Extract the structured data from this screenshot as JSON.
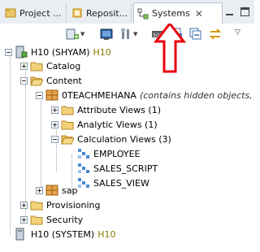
{
  "tabs": [
    {
      "label": "Project ...",
      "icon": "project-explorer-icon",
      "active": false
    },
    {
      "label": "Reposit...",
      "icon": "repository-icon",
      "active": false
    },
    {
      "label": "Systems",
      "icon": "systems-icon",
      "active": true
    }
  ],
  "tree": {
    "system": {
      "name": "H10 (SHYAM)",
      "suffix": "H10"
    },
    "catalog": "Catalog",
    "content": "Content",
    "package": {
      "name": "0TEACHMEHANA",
      "note": "(contains hidden objects,"
    },
    "attribute_views": "Attribute Views (1)",
    "analytic_views": "Analytic Views (1)",
    "calculation_views": "Calculation Views (3)",
    "calc_items": [
      "EMPLOYEE",
      "SALES_SCRIPT",
      "SALES_VIEW"
    ],
    "sap": "sap",
    "provisioning": "Provisioning",
    "security": "Security",
    "system2": {
      "name": "H10 (SYSTEM)",
      "suffix": "H10"
    }
  },
  "colors": {
    "annotation_arrow": "#e8000b",
    "folder": "#e8b84a",
    "suffix": "#8a7c00"
  }
}
